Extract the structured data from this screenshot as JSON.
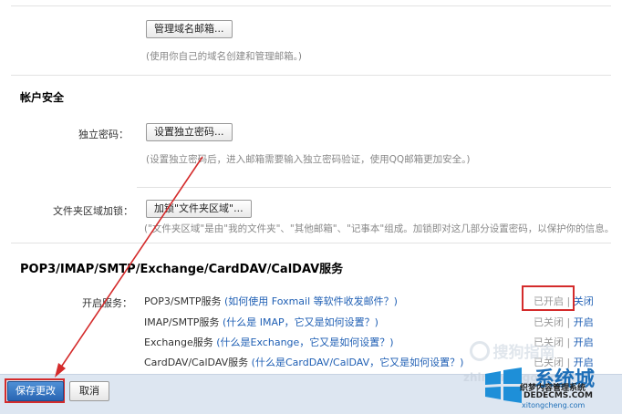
{
  "domain_mail": {
    "button_label": "管理域名邮箱...",
    "hint": "(使用你自己的域名创建和管理邮箱。)"
  },
  "account_security": {
    "title": "帐户安全",
    "password": {
      "label": "独立密码：",
      "button_label": "设置独立密码...",
      "hint": "(设置独立密码后，进入邮箱需要输入独立密码验证，使用QQ邮箱更加安全。)"
    },
    "folder_lock": {
      "label": "文件夹区域加锁：",
      "button_label": "加锁\"文件夹区域\"...",
      "hint": "(\"文件夹区域\"是由\"我的文件夹\"、\"其他邮箱\"、\"记事本\"组成。加锁即对这几部分设置密码，以保护你的信息。"
    }
  },
  "services": {
    "title": "POP3/IMAP/SMTP/Exchange/CardDAV/CalDAV服务",
    "enable_label": "开启服务：",
    "rows": [
      {
        "name": "POP3/SMTP服务",
        "help": "(如何使用 Foxmail 等软件收发邮件？)",
        "status": "已开启",
        "sep": "|",
        "action": "关闭"
      },
      {
        "name": "IMAP/SMTP服务",
        "help": "(什么是 IMAP，它又是如何设置？)",
        "status": "已关闭",
        "sep": "|",
        "action": "开启"
      },
      {
        "name": "Exchange服务",
        "help": "(什么是Exchange，它又是如何设置？)",
        "status": "已关闭",
        "sep": "|",
        "action": "开启"
      },
      {
        "name": "CardDAV/CalDAV服务",
        "help": "(什么是CardDAV/CalDAV，它又是如何设置？)",
        "status": "已关闭",
        "sep": "|",
        "action": "开启"
      }
    ]
  },
  "footer": {
    "save_label": "保存更改",
    "cancel_label": "取消"
  },
  "watermarks": {
    "sogou": "搜狗指南",
    "sogou_url": "zhinan.sogou.com",
    "xitong_name": "系统城",
    "xitong_sub": "织梦内容管理系统",
    "xitong_url": "DEDECMS.COM",
    "xitong_domain": "xitongcheng.com"
  },
  "colors": {
    "accent": "#2a66b3",
    "highlight": "#d42b2b",
    "link": "#1f5fb4"
  }
}
